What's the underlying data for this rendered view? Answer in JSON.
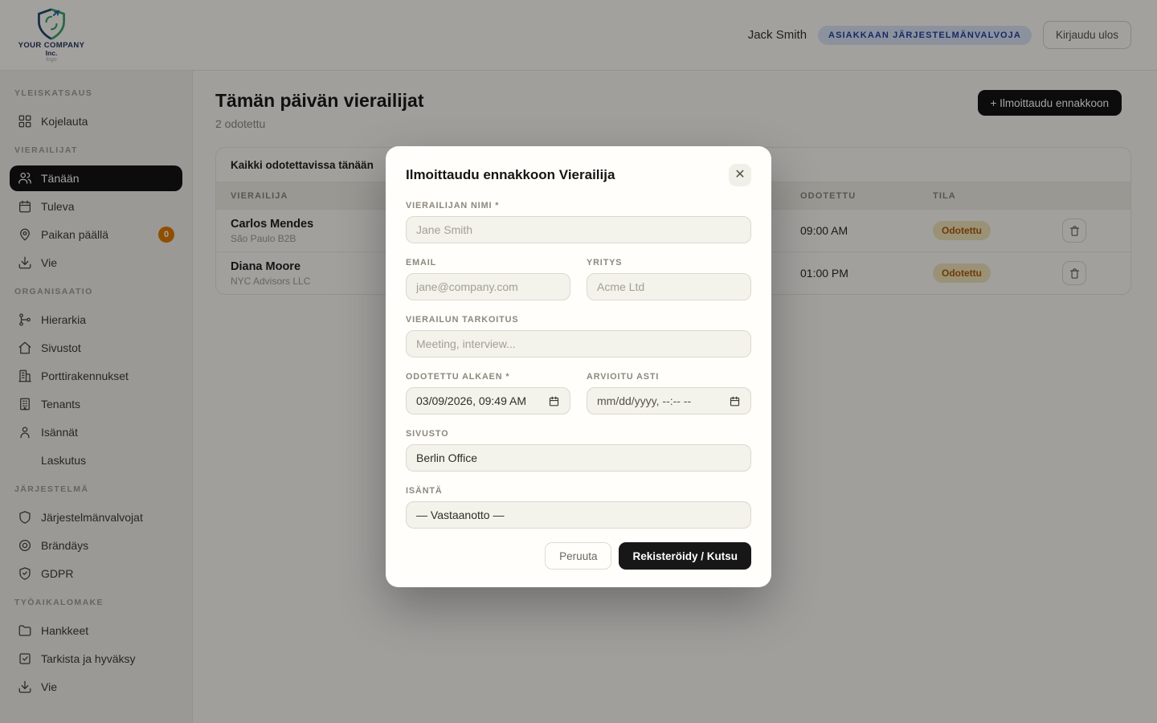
{
  "header": {
    "logo_company": "YOUR COMPANY",
    "logo_inc": "Inc.",
    "logo_caption": "logo",
    "user_name": "Jack Smith",
    "role_badge": "ASIAKKAAN JÄRJESTELMÄNVALVOJA",
    "logout_label": "Kirjaudu ulos"
  },
  "sidebar": {
    "sections": [
      {
        "label": "YLEISKATSAUS",
        "items": [
          {
            "label": "Kojelauta",
            "icon": "dashboard-icon"
          }
        ]
      },
      {
        "label": "VIERAILIJAT",
        "items": [
          {
            "label": "Tänään",
            "icon": "users-icon",
            "active": true
          },
          {
            "label": "Tuleva",
            "icon": "calendar-icon"
          },
          {
            "label": "Paikan päällä",
            "icon": "map-pin-icon",
            "badge": "0"
          },
          {
            "label": "Vie",
            "icon": "download-icon"
          }
        ]
      },
      {
        "label": "ORGANISAATIO",
        "items": [
          {
            "label": "Hierarkia",
            "icon": "hierarchy-icon"
          },
          {
            "label": "Sivustot",
            "icon": "home-icon"
          },
          {
            "label": "Porttirakennukset",
            "icon": "gate-building-icon"
          },
          {
            "label": "Tenants",
            "icon": "building-icon"
          },
          {
            "label": "Isännät",
            "icon": "person-icon"
          },
          {
            "label": "Laskutus",
            "icon": ""
          }
        ]
      },
      {
        "label": "JÄRJESTELMÄ",
        "items": [
          {
            "label": "Järjestelmänvalvojat",
            "icon": "shield-icon"
          },
          {
            "label": "Brändäys",
            "icon": "target-icon"
          },
          {
            "label": "GDPR",
            "icon": "shield-check-icon"
          }
        ]
      },
      {
        "label": "TYÖAIKALOMAKE",
        "items": [
          {
            "label": "Hankkeet",
            "icon": "folder-icon"
          },
          {
            "label": "Tarkista ja hyväksy",
            "icon": "check-square-icon"
          },
          {
            "label": "Vie",
            "icon": "download-icon"
          }
        ]
      }
    ]
  },
  "page": {
    "title": "Tämän päivän vierailijat",
    "subtitle": "2 odotettu",
    "preregister_button": "+ Ilmoittaudu ennakkoon"
  },
  "table": {
    "tab_label": "Kaikki odotettavissa tänään",
    "columns": {
      "visitor": "Vierailija",
      "expected": "Odotettu",
      "status": "Tila"
    },
    "rows": [
      {
        "name": "Carlos Mendes",
        "company": "São Paulo B2B",
        "expected": "09:00 AM",
        "status": "Odotettu"
      },
      {
        "name": "Diana Moore",
        "company": "NYC Advisors LLC",
        "expected": "01:00 PM",
        "status": "Odotettu"
      }
    ]
  },
  "modal": {
    "title": "Ilmoittaudu ennakkoon Vierailija",
    "close_icon": "✕",
    "fields": {
      "name": {
        "label": "Vierailijan nimi *",
        "placeholder": "Jane Smith"
      },
      "email": {
        "label": "Email",
        "placeholder": "jane@company.com"
      },
      "company": {
        "label": "Yritys",
        "placeholder": "Acme Ltd"
      },
      "purpose": {
        "label": "Vierailun tarkoitus",
        "placeholder": "Meeting, interview..."
      },
      "expected_from": {
        "label": "Odotettu alkaen *",
        "value": "03/09/2026, 09:49 AM"
      },
      "estimated_until": {
        "label": "Arvioitu asti",
        "placeholder": "mm/dd/yyyy, --:-- --"
      },
      "site": {
        "label": "Sivusto",
        "value": "Berlin Office"
      },
      "host": {
        "label": "Isäntä",
        "value": "— Vastaanotto —"
      }
    },
    "cancel_label": "Peruuta",
    "submit_label": "Rekisteröidy / Kutsu"
  },
  "colors": {
    "accent_dark": "#141414",
    "brand_navy": "#24476f",
    "brand_green": "#3fa46a",
    "role_badge_bg": "#dbe4f6",
    "role_badge_text": "#27419e",
    "status_badge_bg": "#f1e5ba",
    "status_badge_text": "#b05a0a",
    "sidebar_count_badge": "#e07b00",
    "overlay": "rgba(0,0,0,0.36)"
  }
}
